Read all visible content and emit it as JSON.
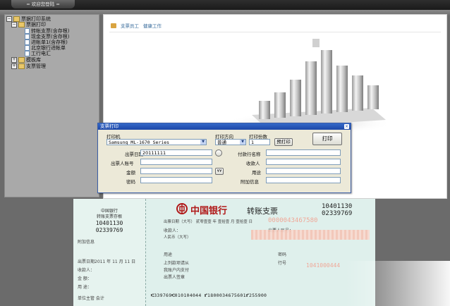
{
  "topbar": {
    "welcome_label": "= 欢迎您登陆 ="
  },
  "tree": {
    "root": "票据打印系统",
    "print": "票据打印",
    "items": [
      "转帐支票(含存根)",
      "现金支票(含存根)",
      "进帐单1(含存根)",
      "北京银行进帐单",
      "工行电汇"
    ],
    "template_lib": "模板库",
    "cheque_mgmt": "支票管理"
  },
  "breadcrumb": {
    "part1": "支票员工",
    "part2": "健康工作"
  },
  "dialog": {
    "title": "支票打印",
    "printer_label": "打印机",
    "printer_value": "Samsung ML-1670 Series",
    "direction_label": "打印方向",
    "direction_value": "普通",
    "copies_label": "打印份数",
    "copies_value": "1",
    "preview_button": "预打印",
    "print_button": "打印",
    "date_label": "出票日期",
    "date_value": "20111111",
    "account_label": "出票人账号",
    "amount_label": "金额",
    "amount_button": "¥¥",
    "password_label": "密码",
    "payee_bank_label": "付款行名称",
    "payee_label": "收款人",
    "purpose_label": "用途",
    "extra_label": "附加信息"
  },
  "cheque": {
    "stub_bank": "中国银行",
    "stub_type": "转账支票存根",
    "stub_no1": "10401130",
    "stub_no2": "02339769",
    "stub_extra": "附加信息",
    "stub_date": "出票日期2011 年 11 月 11 日",
    "stub_payee": "收款人：",
    "stub_amount": "金 额：",
    "stub_purpose": "用 途：",
    "stub_manager": "单位主管    会计",
    "bank_name": "中国银行",
    "cheque_title": "转账支票",
    "no1": "10401130",
    "no2": "02339769",
    "date_line": "出票日期（大写） 贰零壹壹 年 壹拾壹 月 壹拾壹 日",
    "payer_line": "付款行名称：",
    "payee_line": "收款人：",
    "account_line": "出票人账号：",
    "rmb_label": "人民币（大写）",
    "purpose_line": "用途",
    "seal_line1": "上列款项请从",
    "seal_line2": "我账户内支付",
    "seal_line3": "出票人签章",
    "pw_label": "密码",
    "row_label": "行号",
    "faint_num1": "0000043467580",
    "faint_num2": "1041000444",
    "micr": "⑆339769⑆010104044 ⑈1800034675601⑈255900"
  }
}
